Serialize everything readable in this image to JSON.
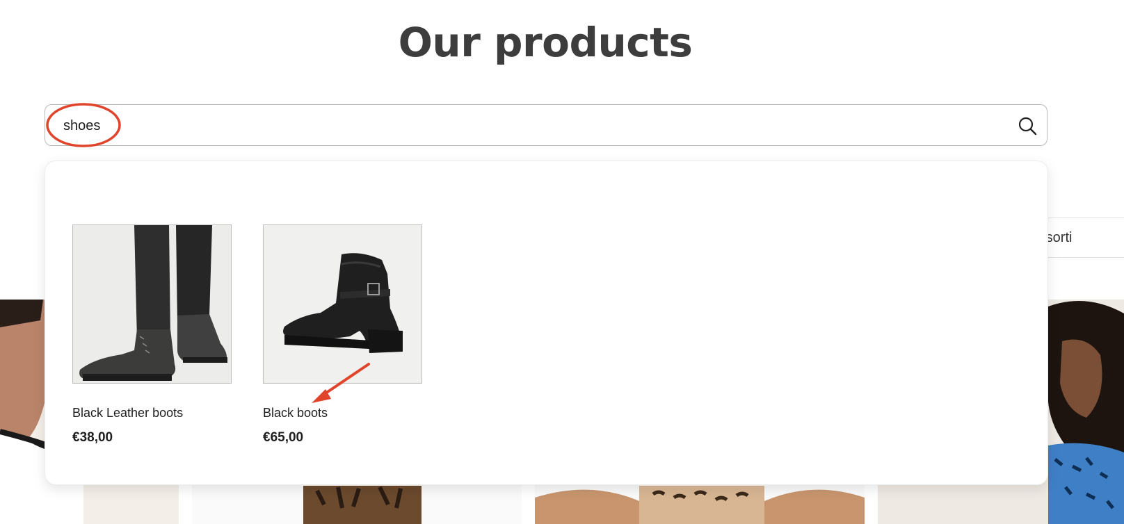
{
  "header": {
    "title": "Our products"
  },
  "search": {
    "value": "shoes",
    "placeholder": ""
  },
  "sort": {
    "visible_label": "ult sorti"
  },
  "results": {
    "products": [
      {
        "name": "Black Leather boots",
        "price": "€38,00",
        "image": "black-leather-boots-photo"
      },
      {
        "name": "Black boots",
        "price": "€65,00",
        "image": "black-ankle-boots-photo"
      }
    ]
  },
  "annotations": {
    "color": "#e0442b"
  },
  "colors": {
    "title": "#3d3d3d",
    "border": "#b9b9b9",
    "text": "#1f1f1f"
  }
}
